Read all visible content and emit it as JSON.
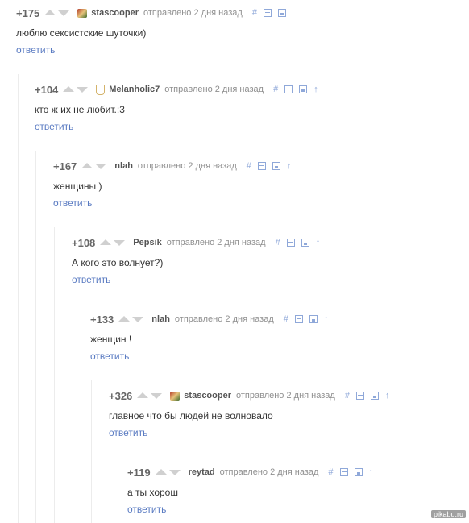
{
  "comments": [
    {
      "rating": "+175",
      "author": "stascooper",
      "meta": "отправлено 2 дня назад",
      "text": "люблю сексистские шуточки)",
      "reply": "ответить",
      "permalink": "#",
      "avatar": "stascooper-avatar",
      "parent_link": false
    },
    {
      "rating": "+104",
      "author": "Melanholic7",
      "meta": "отправлено 2 дня назад",
      "text": "кто ж их не любит.:3",
      "reply": "ответить",
      "permalink": "#",
      "avatar": "melanholic7-avatar",
      "parent_link": true
    },
    {
      "rating": "+167",
      "author": "nlah",
      "meta": "отправлено 2 дня назад",
      "text": "женщины )",
      "reply": "ответить",
      "permalink": "#",
      "parent_link": true
    },
    {
      "rating": "+108",
      "author": "Pepsik",
      "meta": "отправлено 2 дня назад",
      "text": "А кого это волнует?)",
      "reply": "ответить",
      "permalink": "#",
      "parent_link": true
    },
    {
      "rating": "+133",
      "author": "nlah",
      "meta": "отправлено 2 дня назад",
      "text": "женщин !",
      "reply": "ответить",
      "permalink": "#",
      "parent_link": true
    },
    {
      "rating": "+326",
      "author": "stascooper",
      "meta": "отправлено 2 дня назад",
      "text": "главное что бы людей не волновало",
      "reply": "ответить",
      "permalink": "#",
      "avatar": "stascooper-avatar",
      "parent_link": true
    },
    {
      "rating": "+119",
      "author": "reytad",
      "meta": "отправлено 2 дня назад",
      "text": "а ты хорош",
      "reply": "ответить",
      "permalink": "#",
      "parent_link": true
    }
  ],
  "icons": {
    "vote_up": "arrow-up-icon",
    "vote_down": "arrow-down-icon",
    "collapse": "collapse-icon",
    "save": "save-icon",
    "parent": "arrow-parent-icon"
  },
  "colors": {
    "link": "#5a7bc2",
    "tools": "#8fa8d9",
    "rating": "#666666"
  },
  "watermark": "pikabu.ru"
}
